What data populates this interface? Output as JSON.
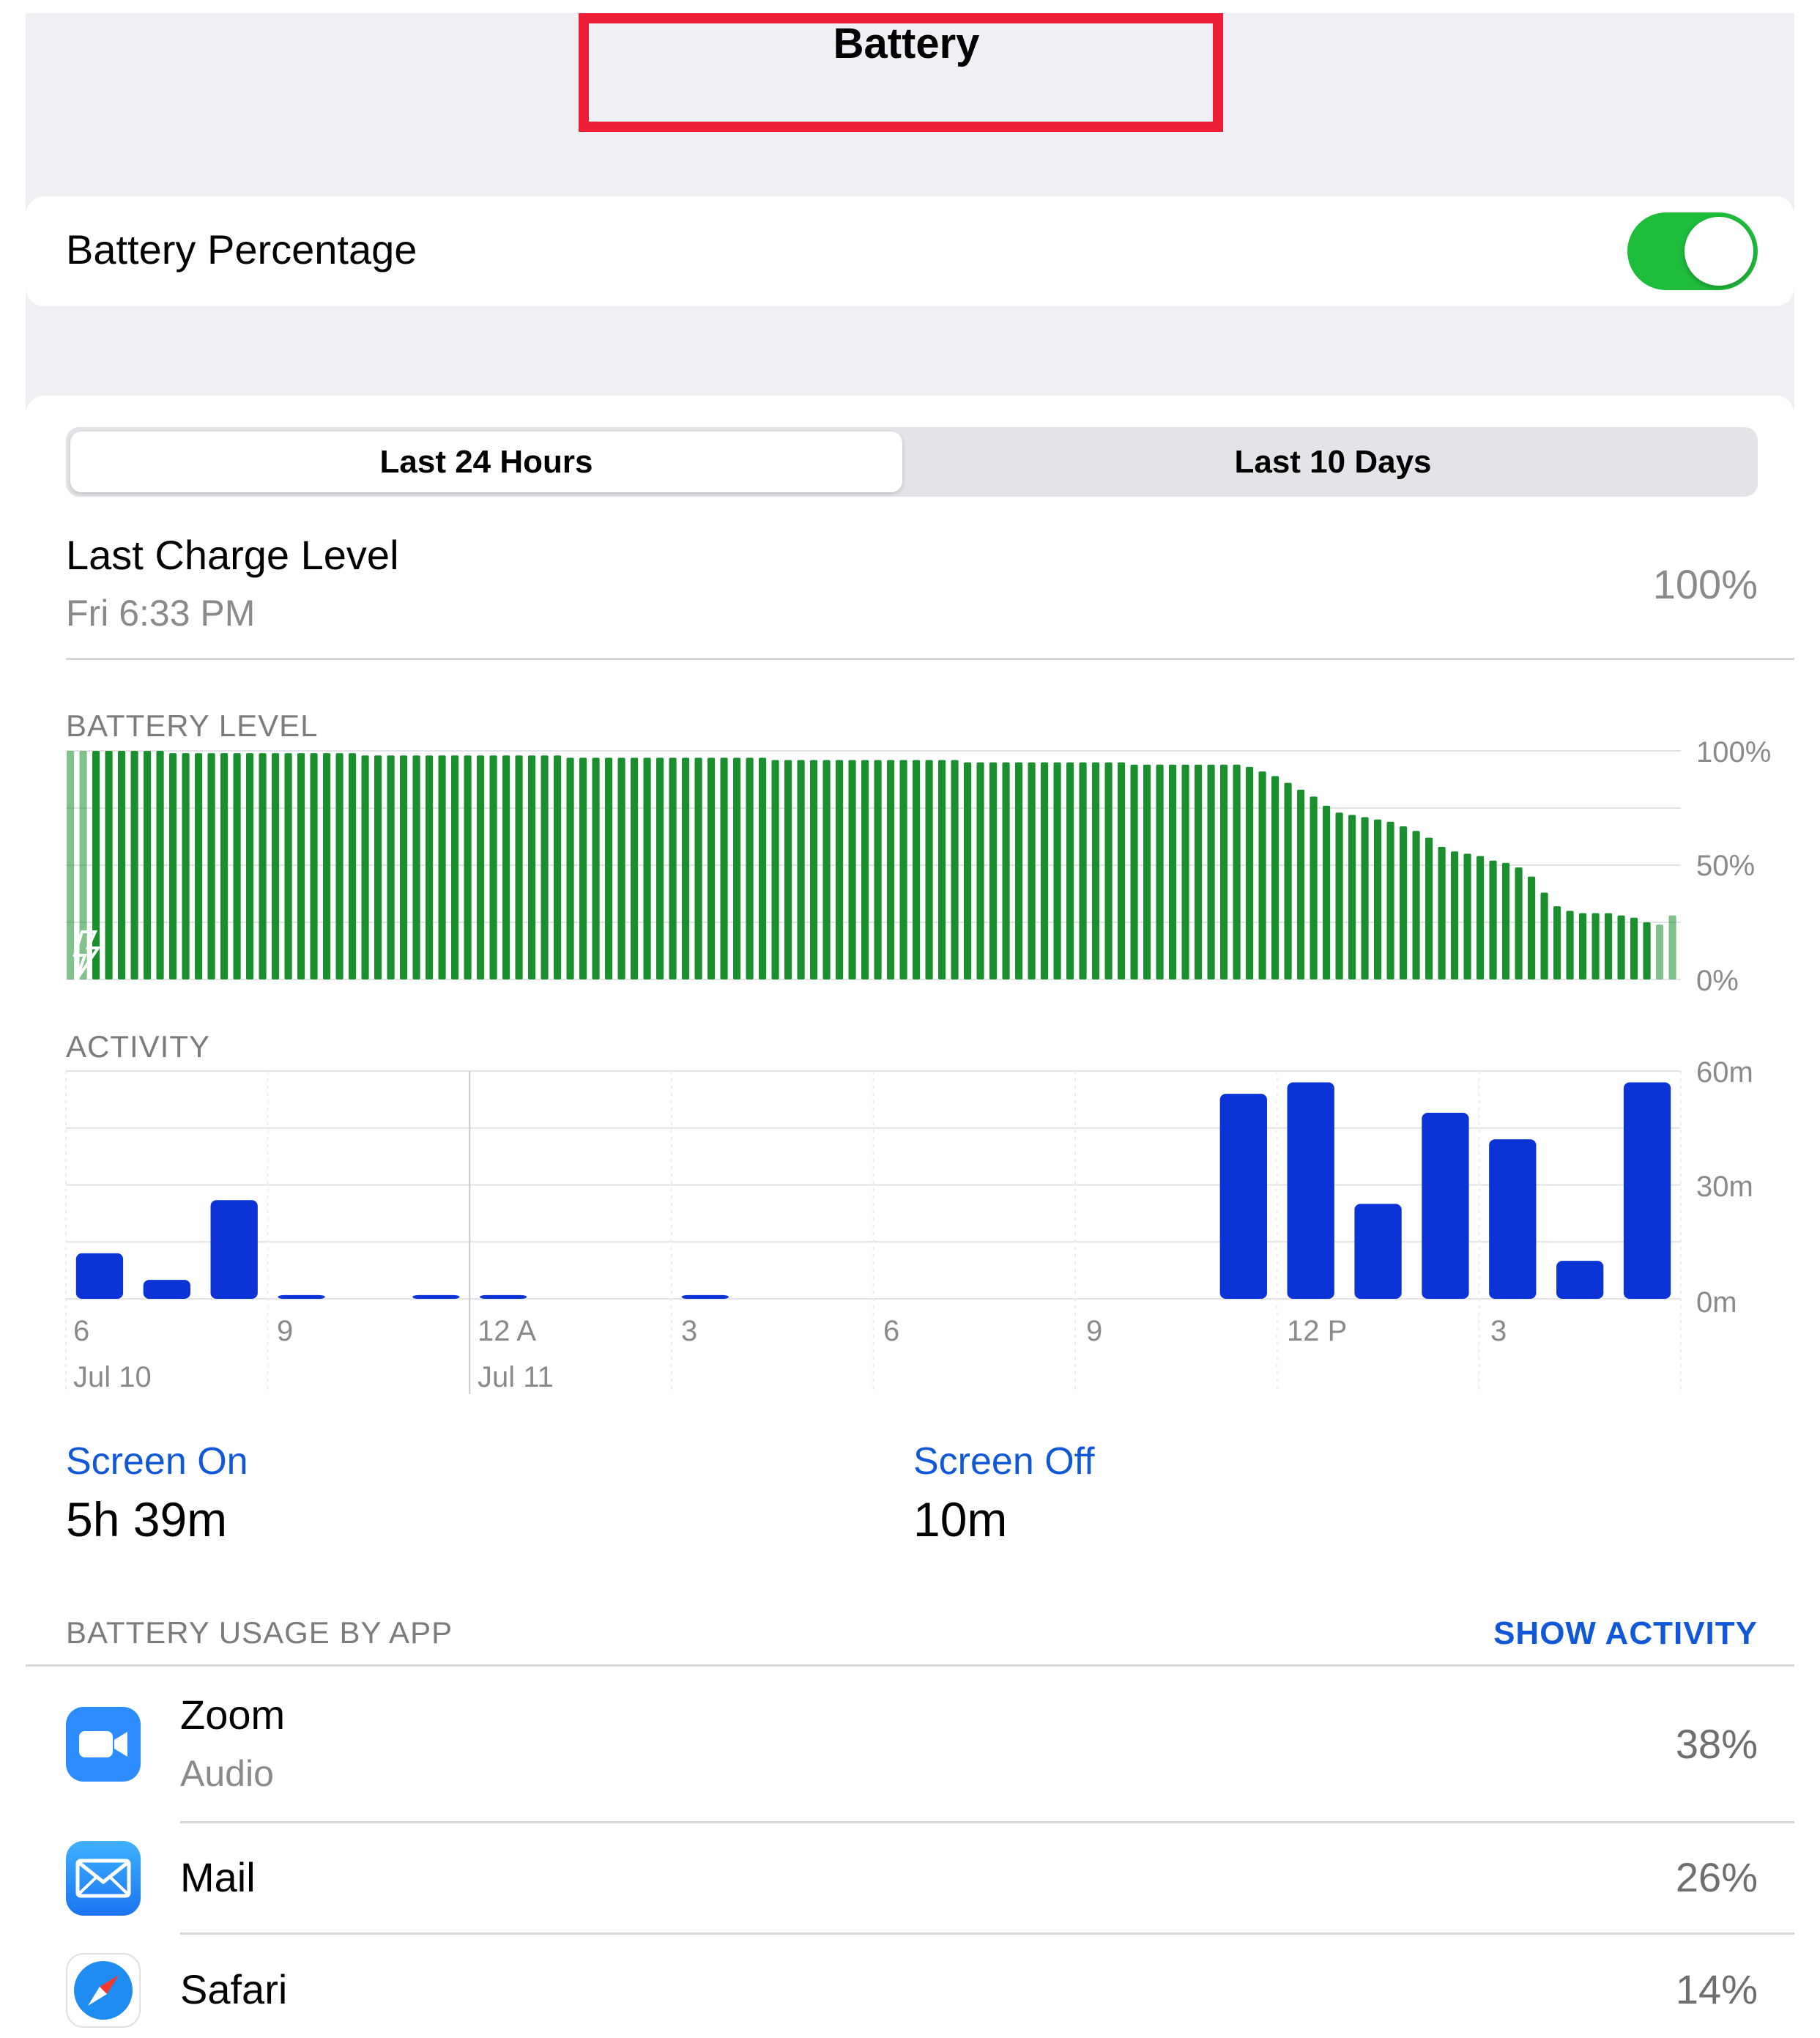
{
  "header": {
    "title": "Battery"
  },
  "toggle_row": {
    "label": "Battery Percentage",
    "enabled": true
  },
  "tabs": [
    {
      "label": "Last 24 Hours",
      "selected": true
    },
    {
      "label": "Last 10 Days",
      "selected": false
    }
  ],
  "last_charge": {
    "title": "Last Charge Level",
    "time": "Fri 6:33 PM",
    "value": "100%"
  },
  "battery_chart": {
    "section_title": "BATTERY LEVEL",
    "y_ticks": [
      "100%",
      "50%",
      "0%"
    ]
  },
  "activity_chart": {
    "section_title": "ACTIVITY",
    "y_ticks": [
      "60m",
      "30m",
      "0m"
    ],
    "x_ticks": [
      "6",
      "9",
      "12 A",
      "3",
      "6",
      "9",
      "12 P",
      "3"
    ],
    "date_labels": [
      "Jul 10",
      "Jul 11"
    ]
  },
  "chart_data": [
    {
      "type": "bar",
      "title": "BATTERY LEVEL",
      "ylabel": "",
      "ylim": [
        0,
        100
      ],
      "y_ticks": [
        "0%",
        "50%",
        "100%"
      ],
      "values": [
        100,
        100,
        100,
        100,
        100,
        100,
        100,
        100,
        99,
        99,
        99,
        99,
        99,
        99,
        99,
        99,
        99,
        99,
        99,
        99,
        99,
        99,
        99,
        98,
        98,
        98,
        98,
        98,
        98,
        98,
        98,
        98,
        98,
        98,
        98,
        98,
        98,
        98,
        98,
        97,
        97,
        97,
        97,
        97,
        97,
        97,
        97,
        97,
        97,
        97,
        97,
        97,
        97,
        97,
        97,
        96,
        96,
        96,
        96,
        96,
        96,
        96,
        96,
        96,
        96,
        96,
        96,
        96,
        96,
        96,
        95,
        95,
        95,
        95,
        95,
        95,
        95,
        95,
        95,
        95,
        95,
        95,
        95,
        94,
        94,
        94,
        94,
        94,
        94,
        94,
        94,
        94,
        93,
        91,
        89,
        86,
        83,
        80,
        76,
        73,
        72,
        71,
        70,
        69,
        67,
        65,
        62,
        58,
        56,
        55,
        54,
        52,
        51,
        49,
        45,
        38,
        32,
        30,
        29,
        29,
        29,
        28,
        27,
        25,
        24,
        28
      ]
    },
    {
      "type": "bar",
      "title": "ACTIVITY",
      "ylabel": "",
      "ylim": [
        0,
        60
      ],
      "y_ticks": [
        "0m",
        "30m",
        "60m"
      ],
      "x_ticks": [
        "6",
        "9",
        "12 A",
        "3",
        "6",
        "9",
        "12 P",
        "3"
      ],
      "date_labels": [
        "Jul 10",
        "Jul 11"
      ],
      "values": [
        12,
        5,
        26,
        1,
        0,
        1,
        1,
        0,
        0,
        1,
        0,
        0,
        0,
        0,
        0,
        0,
        0,
        54,
        57,
        25,
        49,
        42,
        10,
        57
      ]
    }
  ],
  "screen_stats": {
    "on": {
      "label": "Screen On",
      "value": "5h 39m"
    },
    "off": {
      "label": "Screen Off",
      "value": "10m"
    }
  },
  "usage": {
    "title": "BATTERY USAGE BY APP",
    "action": "SHOW ACTIVITY",
    "apps": [
      {
        "name": "Zoom",
        "subtitle": "Audio",
        "percent": "38%",
        "icon": "zoom-icon"
      },
      {
        "name": "Mail",
        "subtitle": "",
        "percent": "26%",
        "icon": "mail-icon"
      },
      {
        "name": "Safari",
        "subtitle": "",
        "percent": "14%",
        "icon": "safari-icon"
      }
    ]
  },
  "colors": {
    "green": "#1a8f2e",
    "blue": "#0b33d6",
    "link": "#1058d8",
    "toggle": "#1fbd3c",
    "highlight": "#ee1e36"
  }
}
